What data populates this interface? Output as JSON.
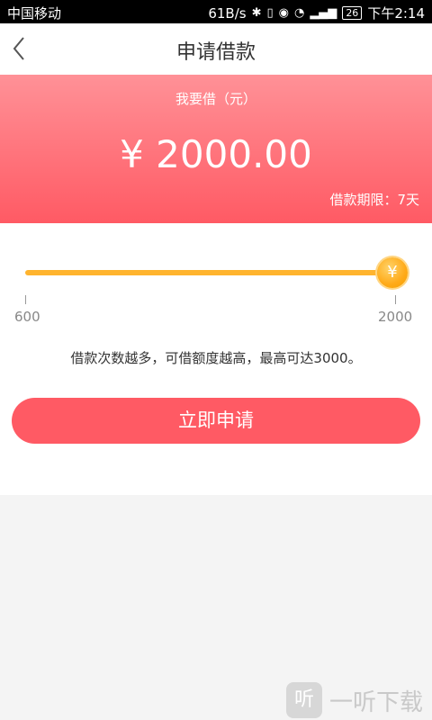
{
  "status": {
    "carrier": "中国移动",
    "speed": "61B/s",
    "battery": "26",
    "time": "下午2:14"
  },
  "header": {
    "title": "申请借款",
    "back_icon": "chevron-left-icon"
  },
  "loan": {
    "label": "我要借（元）",
    "amount": "¥ 2000.00",
    "term": "借款期限：7天"
  },
  "slider": {
    "min_label": "600",
    "max_label": "2000",
    "value": 2000,
    "thumb_symbol": "¥"
  },
  "hint": "借款次数越多，可借额度越高，最高可达3000。",
  "actions": {
    "apply_label": "立即申请"
  },
  "watermark": {
    "logo_char": "听",
    "text": "一听下载"
  },
  "colors": {
    "accent": "#ff5a64",
    "slider": "#ffb42e"
  }
}
